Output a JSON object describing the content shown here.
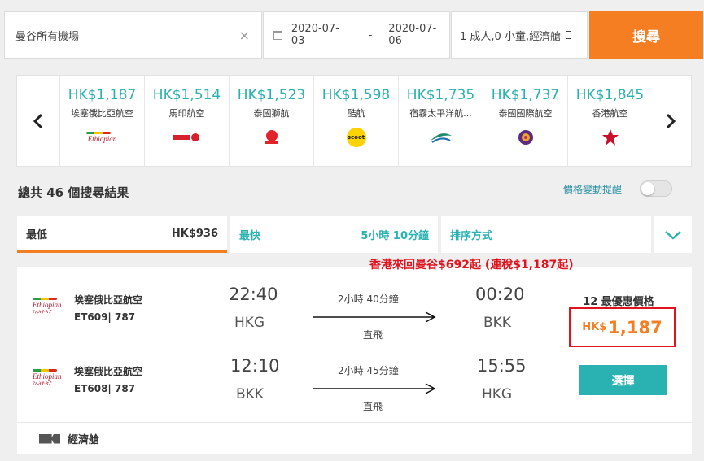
{
  "search": {
    "destination": "曼谷所有機場",
    "clear_icon": "close-icon",
    "date_from": "2020-07-03",
    "date_sep": "-",
    "date_to": "2020-07-06",
    "passengers": "1 成人,0 小童,經濟艙",
    "button": "搜尋"
  },
  "carousel": {
    "prev": "‹",
    "next": "›",
    "items": [
      {
        "price": "HK$1,187",
        "airline": "埃塞俄比亞航空",
        "logo": "ethiopian-logo"
      },
      {
        "price": "HK$1,514",
        "airline": "馬印航空",
        "logo": "malindo-logo"
      },
      {
        "price": "HK$1,523",
        "airline": "泰國獅航",
        "logo": "thai-lion-logo"
      },
      {
        "price": "HK$1,598",
        "airline": "酷航",
        "logo": "scoot-logo",
        "logo_text": "scoot"
      },
      {
        "price": "HK$1,735",
        "airline": "宿霧太平洋航...",
        "logo": "cebu-pacific-logo"
      },
      {
        "price": "HK$1,737",
        "airline": "泰國國際航空",
        "logo": "thai-airways-logo"
      },
      {
        "price": "HK$1,845",
        "airline": "香港航空",
        "logo": "hk-airlines-logo"
      }
    ]
  },
  "results": {
    "total": "總共 46 個搜尋結果",
    "price_alert": "價格變動提醒"
  },
  "tabs": {
    "lowest_label": "最低",
    "lowest_value": "HK$936",
    "fastest_label": "最快",
    "fastest_value": "5小時 10分鐘",
    "sort_label": "排序方式",
    "dropdown_icon": "chevron-down-icon"
  },
  "promo": "香港來回曼谷$692起 (連稅$1,187起)",
  "flight": {
    "outbound": {
      "airline": "埃塞俄比亞航空",
      "flight_no": "ET609| 787",
      "dep_time": "22:40",
      "dep_airport": "HKG",
      "duration": "2小時 40分鐘",
      "stops": "直飛",
      "arr_time": "00:20",
      "arr_airport": "BKK"
    },
    "inbound": {
      "airline": "埃塞俄比亞航空",
      "flight_no": "ET608| 787",
      "dep_time": "12:10",
      "dep_airport": "BKK",
      "duration": "2小時 45分鐘",
      "stops": "直飛",
      "arr_time": "15:55",
      "arr_airport": "HKG"
    },
    "logo_text": "Ethiopian",
    "logo_sub": "የኢትዮጵያ",
    "best_label": "12 最優惠價格",
    "currency": "HK$",
    "price": "1,187",
    "select": "選擇",
    "cabin": "經濟艙"
  },
  "colors": {
    "accent": "#f67e22",
    "teal": "#2ab1b1",
    "red": "#e0141e"
  }
}
